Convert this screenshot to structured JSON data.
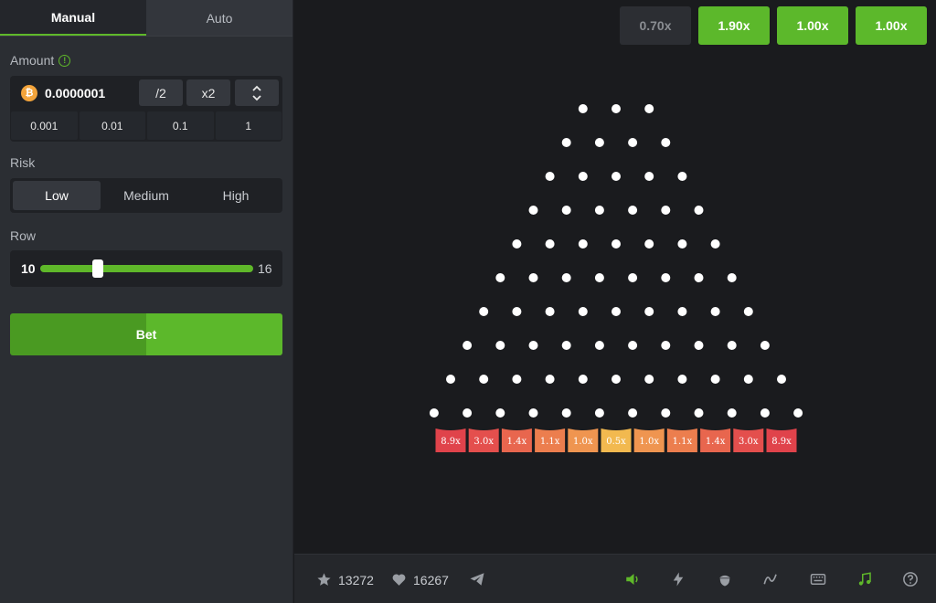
{
  "tabs": [
    {
      "label": "Manual",
      "active": true
    },
    {
      "label": "Auto",
      "active": false
    }
  ],
  "amount": {
    "label": "Amount",
    "value": "0.0000001",
    "currency_icon": "bitcoin-icon",
    "half_label": "/2",
    "double_label": "x2",
    "quick": [
      "0.001",
      "0.01",
      "0.1",
      "1"
    ]
  },
  "risk": {
    "label": "Risk",
    "options": [
      "Low",
      "Medium",
      "High"
    ],
    "selected": "Low"
  },
  "row": {
    "label": "Row",
    "min": "10",
    "max": "16",
    "slider_fraction": 0.27
  },
  "bet_label": "Bet",
  "history": [
    {
      "label": "0.70x",
      "color": "#2c2e33",
      "text_color": "#8a8d92"
    },
    {
      "label": "1.90x",
      "color": "#5cb82b",
      "text_color": "#ffffff"
    },
    {
      "label": "1.00x",
      "color": "#5cb82b",
      "text_color": "#ffffff"
    },
    {
      "label": "1.00x",
      "color": "#5cb82b",
      "text_color": "#ffffff"
    }
  ],
  "board": {
    "rows": 10,
    "multipliers": [
      {
        "label": "8.9x",
        "color": "#e0434b"
      },
      {
        "label": "3.0x",
        "color": "#e44f4d"
      },
      {
        "label": "1.4x",
        "color": "#e8664e"
      },
      {
        "label": "1.1x",
        "color": "#ec7e4e"
      },
      {
        "label": "1.0x",
        "color": "#ef9550"
      },
      {
        "label": "0.5x",
        "color": "#f2b94f"
      },
      {
        "label": "1.0x",
        "color": "#ef9550"
      },
      {
        "label": "1.1x",
        "color": "#ec7e4e"
      },
      {
        "label": "1.4x",
        "color": "#e8664e"
      },
      {
        "label": "3.0x",
        "color": "#e44f4d"
      },
      {
        "label": "8.9x",
        "color": "#e0434b"
      }
    ]
  },
  "footer": {
    "stars": "13272",
    "likes": "16267",
    "icons": [
      "volume-icon",
      "lightning-icon",
      "acorn-icon",
      "curve-icon",
      "keyboard-icon",
      "music-icon",
      "help-icon"
    ],
    "accent": "#5fb82a"
  }
}
